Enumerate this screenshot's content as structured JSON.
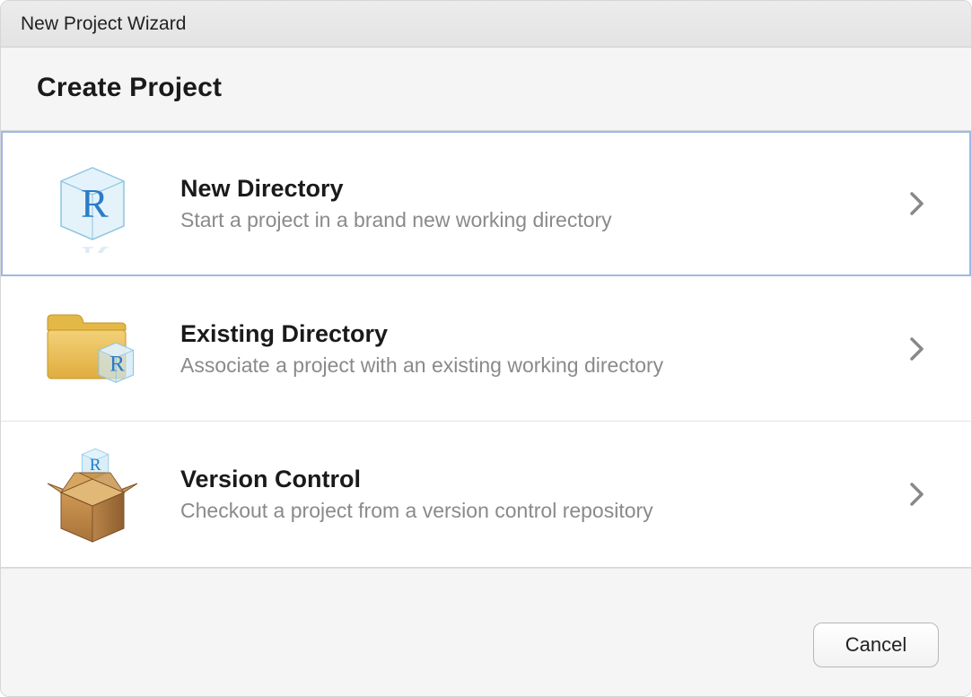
{
  "window": {
    "title": "New Project Wizard"
  },
  "header": {
    "title": "Create Project"
  },
  "options": [
    {
      "title": "New Directory",
      "desc": "Start a project in a brand new working directory",
      "icon": "cube-r-icon",
      "selected": true
    },
    {
      "title": "Existing Directory",
      "desc": "Associate a project with an existing working directory",
      "icon": "folder-cube-icon",
      "selected": false
    },
    {
      "title": "Version Control",
      "desc": "Checkout a project from a version control repository",
      "icon": "box-cube-icon",
      "selected": false
    }
  ],
  "footer": {
    "cancel_label": "Cancel"
  }
}
